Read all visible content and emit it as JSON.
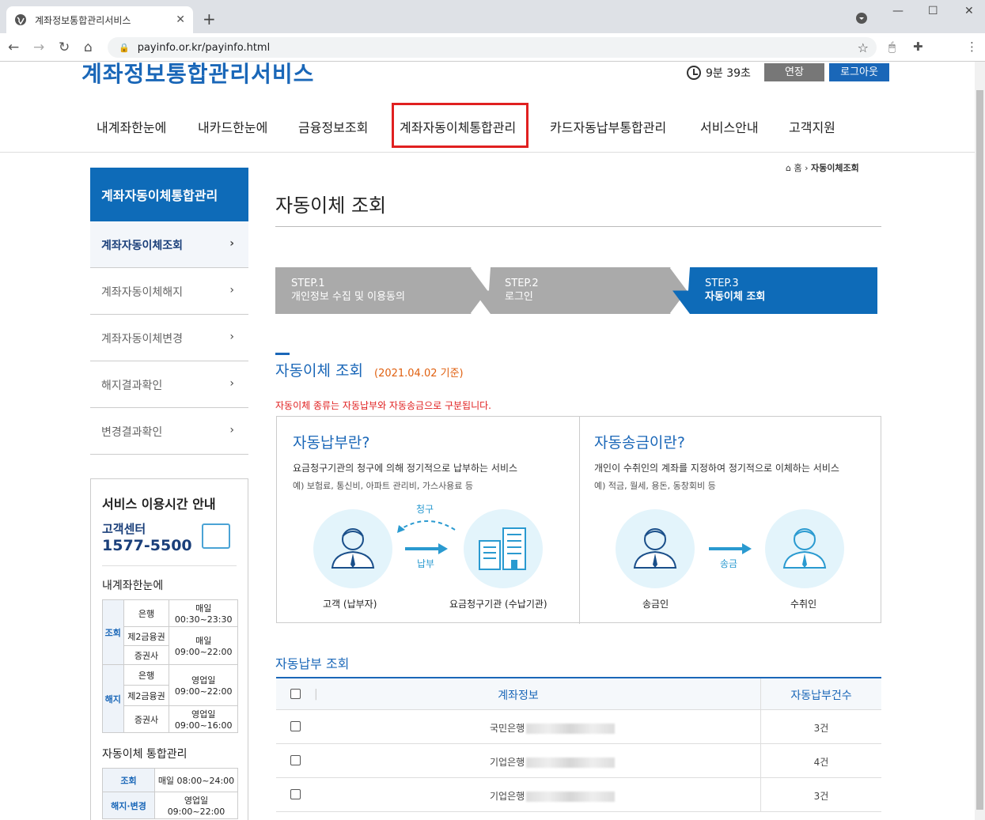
{
  "browser": {
    "tab_title": "계좌정보통합관리서비스",
    "url": "payinfo.or.kr/payinfo.html"
  },
  "header": {
    "logo": "계좌정보통합관리서비스",
    "timer": "9분 39초",
    "extend": "연장",
    "logout": "로그아웃"
  },
  "gnb": [
    "내계좌한눈에",
    "내카드한눈에",
    "금융정보조회",
    "계좌자동이체통합관리",
    "카드자동납부통합관리",
    "서비스안내",
    "고객지원"
  ],
  "breadcrumb": {
    "home": "홈",
    "current": "자동이체조회"
  },
  "lnb": {
    "title": "계좌자동이체통합관리",
    "items": [
      "계좌자동이체조회",
      "계좌자동이체해지",
      "계좌자동이체변경",
      "해지결과확인",
      "변경결과확인"
    ]
  },
  "service_hours": {
    "title": "서비스 이용시간 안내",
    "center": "고객센터",
    "phone": "1577-5500",
    "sec1": "내계좌한눈에",
    "t1": {
      "query": "조회",
      "cancel": "해지",
      "bank": "은행",
      "second": "제2금융권",
      "sec": "증권사",
      "q1": "매일\n00:30~23:30",
      "q2": "매일\n09:00~22:00",
      "c1": "영업일\n09:00~22:00",
      "c2": "영업일\n09:00~16:00"
    },
    "sec2": "자동이체 통합관리",
    "t2": {
      "query": "조회",
      "qv": "매일 08:00~24:00",
      "cancel": "해지·변경",
      "cv": "영업일 09:00~22:00"
    }
  },
  "page_title": "자동이체 조회",
  "steps": [
    {
      "num": "STEP.1",
      "label": "개인정보 수집 및 이용동의"
    },
    {
      "num": "STEP.2",
      "label": "로그인"
    },
    {
      "num": "STEP.3",
      "label": "자동이체 조회"
    }
  ],
  "section": {
    "title": "자동이체 조회",
    "date": "(2021.04.02 기준)",
    "notice": "자동이체 종류는 자동납부와 자동송금으로 구분됩니다."
  },
  "auto_pay": {
    "title": "자동납부란?",
    "desc": "요금청구기관의 청구에 의해 정기적으로 납부하는 서비스",
    "example": "예) 보험료, 통신비, 아파트 관리비, 가스사용료 등",
    "claim": "청구",
    "pay": "납부",
    "customer": "고객 (납부자)",
    "agency": "요금청구기관 (수납기관)"
  },
  "auto_send": {
    "title": "자동송금이란?",
    "desc": "개인이 수취인의 계좌를 지정하여 정기적으로 이체하는 서비스",
    "example": "예) 적금, 월세, 용돈, 동창회비 등",
    "send": "송금",
    "sender": "송금인",
    "receiver": "수취인"
  },
  "table": {
    "title": "자동납부 조회",
    "headers": {
      "account": "계좌정보",
      "count": "자동납부건수"
    },
    "rows": [
      {
        "bank": "국민은행",
        "count": "3건"
      },
      {
        "bank": "기업은행",
        "count": "4건"
      },
      {
        "bank": "기업은행",
        "count": "3건"
      }
    ]
  }
}
